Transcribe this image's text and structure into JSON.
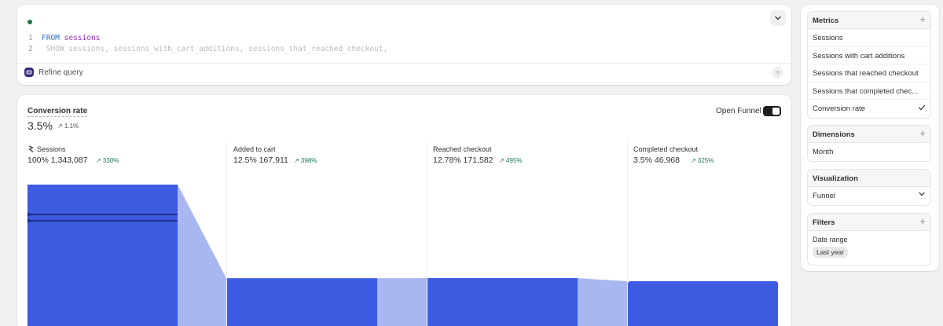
{
  "query": {
    "line_numbers": [
      "1",
      "2"
    ],
    "line1_keyword": "FROM",
    "line1_table": "sessions",
    "line2_text": "SHOW sessions, sessions_with_cart_additions, sessions_that_reached_checkout,",
    "refine_label": "Refine query",
    "status_color": "#1e7a4f"
  },
  "metric": {
    "title": "Conversion rate",
    "value": "3.5%",
    "change": "↗ 1.1%"
  },
  "open_funnel": {
    "label": "Open Funnel",
    "enabled": true
  },
  "chart_data": {
    "type": "funnel",
    "bar_color": "#3d5be0",
    "connector_color": "#a9b7f0",
    "ymax": 1343087,
    "stages": [
      {
        "name": "Sessions",
        "pct": "100%",
        "count": "1,343,087",
        "value": 1343087,
        "change": "↗ 330%"
      },
      {
        "name": "Added to cart",
        "pct": "12.5%",
        "count": "167,911",
        "value": 167911,
        "change": "↗ 398%"
      },
      {
        "name": "Reached checkout",
        "pct": "12.78%",
        "count": "171,582",
        "value": 171582,
        "change": "↗ 495%"
      },
      {
        "name": "Completed checkout",
        "pct": "3.5%",
        "count": "46,968",
        "value": 46968,
        "change": "↗ 325%"
      }
    ]
  },
  "sidebar": {
    "metrics": {
      "title": "Metrics",
      "items": [
        "Sessions",
        "Sessions with cart additions",
        "Sessions that reached checkout",
        "Sessions that completed chec...",
        "Conversion rate"
      ],
      "selected": "Conversion rate"
    },
    "dimensions": {
      "title": "Dimensions",
      "items": [
        "Month"
      ]
    },
    "visualization": {
      "title": "Visualization",
      "value": "Funnel"
    },
    "filters": {
      "title": "Filters",
      "label": "Date range",
      "value": "Last year"
    }
  }
}
